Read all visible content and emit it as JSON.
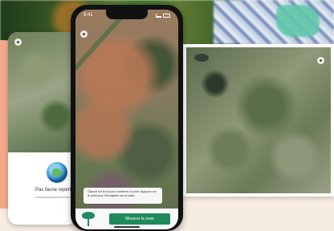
{
  "status_bar": {
    "time": "9:41"
  },
  "left_phone": {
    "panel_title": "Pas faune reperte"
  },
  "center_phone": {
    "info_text": "Cliquez sur le sol pour confirmer le point. Appuyez sur le point pour l'enregistrer sur la carte.",
    "cta_label": "Mesurer la zone"
  },
  "icons": [
    "globe-icon",
    "tree-icon",
    "location-icon",
    "signal-icon",
    "battery-icon"
  ],
  "colors": {
    "brand_green": "#1f8a5c",
    "background": "#f6ece1",
    "accent_peach": "#f1a98a"
  }
}
